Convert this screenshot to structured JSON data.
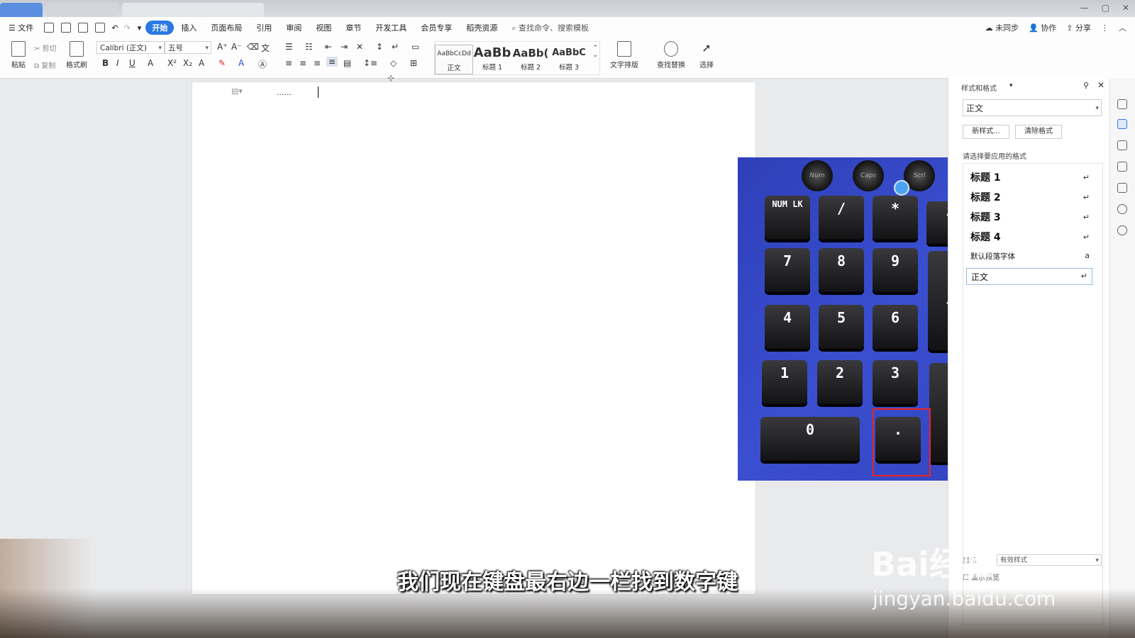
{
  "menubar": {
    "file": "文件",
    "tabs": [
      "开始",
      "插入",
      "页面布局",
      "引用",
      "审阅",
      "视图",
      "章节",
      "开发工具",
      "会员专享",
      "稻壳资源"
    ],
    "search": "查找命令、搜索模板",
    "right": [
      "未同步",
      "协作",
      "分享"
    ]
  },
  "ribbon": {
    "paste": "粘贴",
    "cut": "剪切",
    "copy": "复制",
    "format_painter": "格式刷",
    "font": "Calibri (正文)",
    "size": "五号",
    "styles": [
      {
        "preview": "AaBbCcDd",
        "label": "正文"
      },
      {
        "preview": "AaBb",
        "label": "标题 1"
      },
      {
        "preview": "AaBb(",
        "label": "标题 2"
      },
      {
        "preview": "AaBbC",
        "label": "标题 3"
      }
    ],
    "text_layout": "文字排版",
    "find_replace": "查找替换",
    "select": "选择"
  },
  "document": {
    "text": "......"
  },
  "keyboard": {
    "knobs": [
      "Num",
      "Caps",
      "Scrl"
    ],
    "keys": [
      "NUM LK",
      "/",
      "*",
      "-",
      "7",
      "8",
      "9",
      "+",
      "4",
      "5",
      "6",
      "1",
      "2",
      "3",
      "0",
      "."
    ]
  },
  "panel": {
    "title": "样式和格式",
    "current_style": "正文",
    "new_style": "新样式...",
    "clear_format": "清除格式",
    "prompt": "请选择要应用的格式",
    "styles": [
      "标题 1",
      "标题 2",
      "标题 3",
      "标题 4"
    ],
    "default_font": "默认段落字体",
    "body_style": "正文",
    "show_label": "显示",
    "show_value": "有效样式",
    "preview_label": "显示预览"
  },
  "subtitle": "我们现在键盘最右边一栏找到数字键",
  "watermark": {
    "brand": "Bai经验",
    "url": "jingyan.baidu.com"
  },
  "colors": {
    "accent": "#2a78e4",
    "highlight": "#e22222",
    "keyboard_bg": "#3445c0"
  }
}
